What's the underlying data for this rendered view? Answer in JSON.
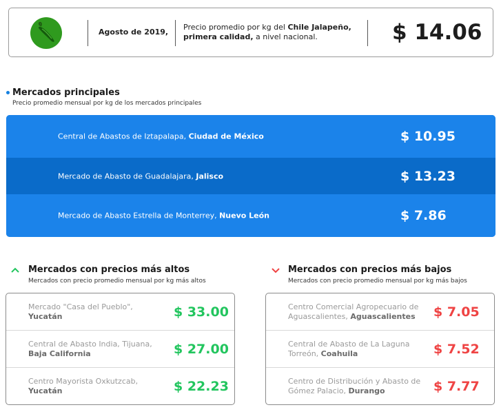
{
  "header": {
    "date": "Agosto de 2019,",
    "desc_prefix": "Precio promedio por kg del ",
    "product": "Chile Jalapeño,",
    "quality": "primera calidad,",
    "desc_suffix": " a nivel nacional.",
    "price": "$ 14.06",
    "icon": "chile-pepper-icon"
  },
  "main": {
    "title": "Mercados principales",
    "subtitle": "Precio promedio mensual por kg de los mercados principales",
    "rows": [
      {
        "market": "Central de Abastos de Iztapalapa, ",
        "region": "Ciudad de México",
        "price": "$ 10.95"
      },
      {
        "market": "Mercado de Abasto de Guadalajara, ",
        "region": "Jalisco",
        "price": "$ 13.23"
      },
      {
        "market": "Mercado de Abasto Estrella de Monterrey, ",
        "region": "Nuevo León",
        "price": "$ 7.86"
      }
    ]
  },
  "high": {
    "title": "Mercados con precios más altos",
    "subtitle": "Mercados con precio promedio mensual por kg más altos",
    "rows": [
      {
        "market": "Mercado \"Casa del Pueblo\",",
        "region": "Yucatán",
        "price": "$ 33.00"
      },
      {
        "market": "Central de Abasto India, Tijuana,",
        "region": "Baja California",
        "price": "$ 27.00"
      },
      {
        "market": "Centro Mayorista Oxkutzcab,",
        "region": "Yucatán",
        "price": "$ 22.23"
      }
    ]
  },
  "low": {
    "title": "Mercados con precios más bajos",
    "subtitle": "Mercados con precio promedio mensual por kg más bajos",
    "rows": [
      {
        "market": "Centro Comercial Agropecuario de Aguascalientes, ",
        "region": "Aguascalientes",
        "price": "$ 7.05"
      },
      {
        "market": "Central de Abasto de La Laguna Torreón, ",
        "region": "Coahuila",
        "price": "$ 7.52"
      },
      {
        "market": "Centro de Distribución y Abasto de Gómez Palacio, ",
        "region": "Durango",
        "price": "$ 7.77"
      }
    ]
  },
  "colors": {
    "accent": "#1981e8",
    "accent_dark": "#0a6bc9",
    "high_price": "#22c55e",
    "low_price": "#ef4444"
  }
}
